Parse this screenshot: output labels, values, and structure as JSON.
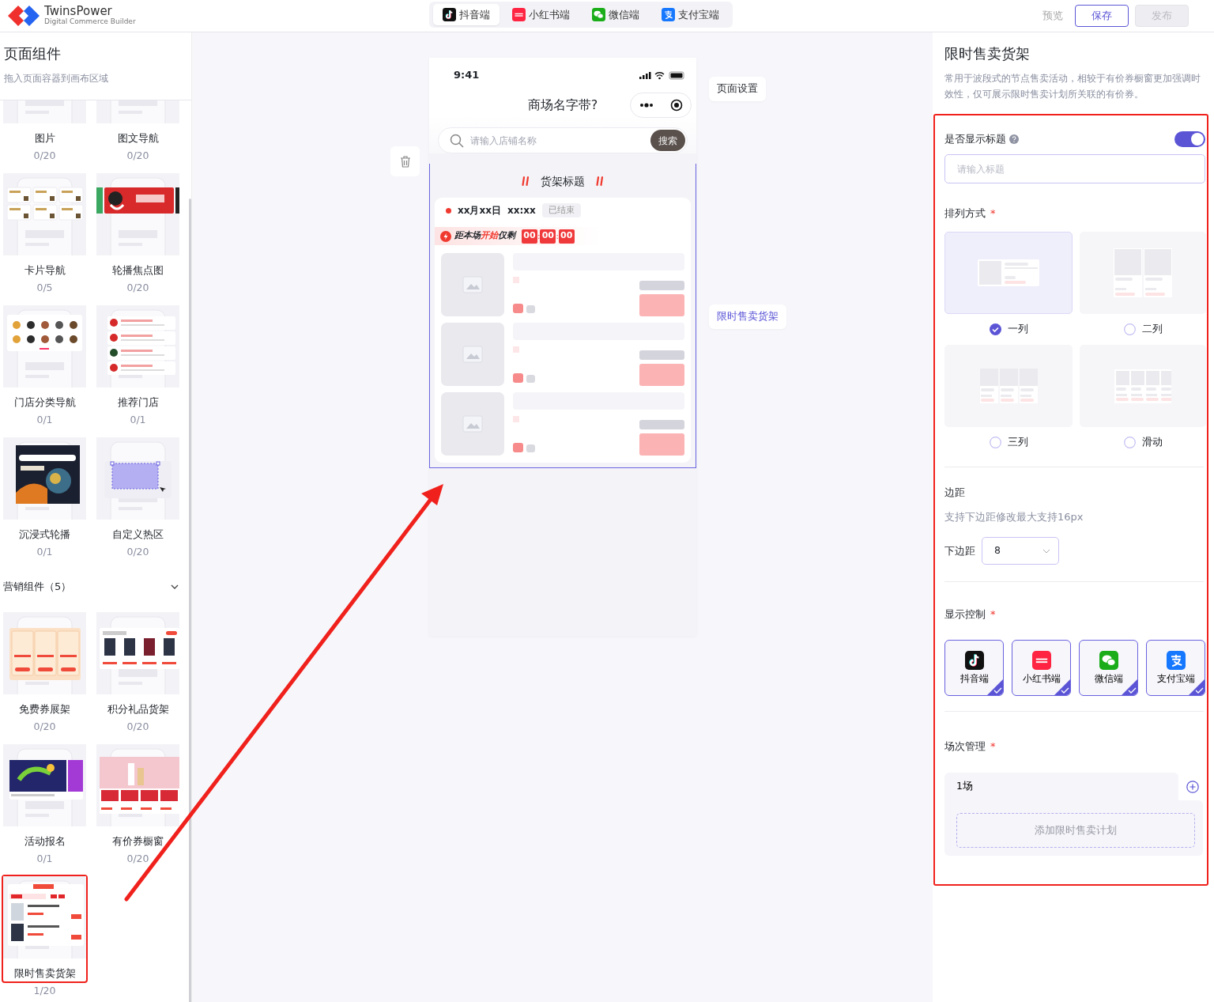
{
  "header": {
    "logo": {
      "name": "TwinsPower",
      "tagline": "Digital Commerce Builder"
    },
    "platform_tabs": [
      {
        "label": "抖音端",
        "kind": "douyin",
        "selected": true
      },
      {
        "label": "小红书端",
        "kind": "xiaohongshu",
        "selected": false
      },
      {
        "label": "微信端",
        "kind": "wechat",
        "selected": false
      },
      {
        "label": "支付宝端",
        "kind": "alipay",
        "selected": false
      }
    ],
    "actions": [
      {
        "label": "预览",
        "kind": "link",
        "disabled": false
      },
      {
        "label": "保存",
        "kind": "outline",
        "disabled": false
      },
      {
        "label": "发布",
        "kind": "solid",
        "disabled": true
      }
    ]
  },
  "sidebar": {
    "title": "页面组件",
    "hint": "拖入页面容器到画布区域",
    "groups": [
      {
        "tiles": [
          {
            "label": "图片",
            "count": "0/20",
            "kind": "image",
            "highlighted": false
          },
          {
            "label": "图文导航",
            "count": "0/20",
            "kind": "textnav",
            "highlighted": false
          },
          {
            "label": "卡片导航",
            "count": "0/5",
            "kind": "cards",
            "highlighted": false
          },
          {
            "label": "轮播焦点图",
            "count": "0/20",
            "kind": "carousel",
            "highlighted": false
          },
          {
            "label": "门店分类导航",
            "count": "0/1",
            "kind": "category",
            "highlighted": false
          },
          {
            "label": "推荐门店",
            "count": "0/1",
            "kind": "stores",
            "highlighted": false
          },
          {
            "label": "沉浸式轮播",
            "count": "0/1",
            "kind": "immersive",
            "highlighted": false
          },
          {
            "label": "自定义热区",
            "count": "0/20",
            "kind": "hotzone",
            "highlighted": false
          }
        ]
      },
      {
        "title": "营销组件（5）",
        "expanded": true,
        "tiles": [
          {
            "label": "免费券展架",
            "count": "0/20",
            "kind": "coupon",
            "highlighted": false
          },
          {
            "label": "积分礼品货架",
            "count": "0/20",
            "kind": "points",
            "highlighted": false
          },
          {
            "label": "活动报名",
            "count": "0/1",
            "kind": "signup",
            "highlighted": false
          },
          {
            "label": "有价券橱窗",
            "count": "0/20",
            "kind": "beauty",
            "highlighted": false
          },
          {
            "label": "限时售卖货架",
            "count": "1/20",
            "kind": "flash",
            "highlighted": true
          }
        ]
      }
    ]
  },
  "canvas": {
    "phone": {
      "time": "9:41",
      "title": "商场名字带?",
      "search": {
        "placeholder": "请输入店铺名称",
        "button": "搜索"
      },
      "shelf": {
        "title": "货架标题",
        "selected": true,
        "session": {
          "date": "xx月xx日",
          "time": "xx:xx",
          "status": "已结束",
          "countdown": {
            "before": "距本场",
            "highlight": "开始",
            "after": "仅剩"
          },
          "timer": [
            "00",
            "00",
            "00"
          ],
          "separators": [
            ":",
            ":"
          ]
        },
        "items": [
          {
            "kind": "placeholder"
          },
          {
            "kind": "placeholder"
          },
          {
            "kind": "placeholder"
          }
        ]
      }
    },
    "side_tags": [
      {
        "label": "页面设置",
        "selected": false
      },
      {
        "label": "限时售卖货架",
        "selected": true
      }
    ]
  },
  "settings": {
    "title": "限时售卖货架",
    "description": "常用于波段式的节点售卖活动，相较于有价券橱窗更加强调时效性，仅可展示限时售卖计划所关联的有价券。",
    "highlighted": true,
    "show_title": {
      "label": "是否显示标题",
      "on": true,
      "placeholder": "请输入标题"
    },
    "layout": {
      "label": "排列方式",
      "required_mark": "*",
      "options": [
        {
          "label": "一列",
          "kind": "one",
          "selected": true
        },
        {
          "label": "二列",
          "kind": "two",
          "selected": false
        },
        {
          "label": "三列",
          "kind": "three",
          "selected": false
        },
        {
          "label": "滑动",
          "kind": "scroll",
          "selected": false
        }
      ]
    },
    "margin": {
      "label": "边距",
      "hint": "支持下边距修改最大支持16px",
      "field_label": "下边距",
      "value": "8"
    },
    "visibility": {
      "label": "显示控制",
      "required_mark": "*",
      "platforms": [
        {
          "label": "抖音端",
          "kind": "douyin",
          "checked": true
        },
        {
          "label": "小红书端",
          "kind": "xiaohongshu",
          "checked": true
        },
        {
          "label": "微信端",
          "kind": "wechat",
          "checked": true
        },
        {
          "label": "支付宝端",
          "kind": "alipay",
          "checked": true
        }
      ]
    },
    "sessions": {
      "label": "场次管理",
      "required_mark": "*",
      "tabs": [
        {
          "label": "1场",
          "selected": true
        }
      ],
      "add_button": "添加限时售卖计划"
    }
  }
}
